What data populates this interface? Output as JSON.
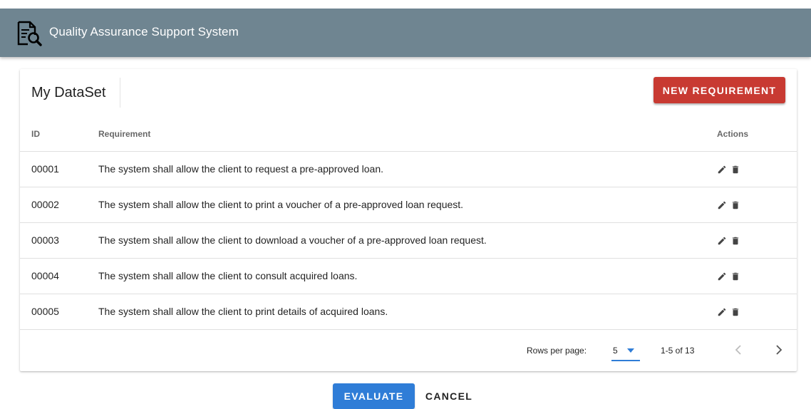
{
  "app": {
    "title": "Quality Assurance Support System",
    "header_color": "#6f8591"
  },
  "card": {
    "title": "My DataSet",
    "new_button_label": "NEW REQUIREMENT",
    "new_button_color": "#c83a32"
  },
  "table": {
    "columns": [
      "ID",
      "Requirement",
      "Actions"
    ],
    "rows": [
      {
        "id": "00001",
        "requirement": "The system shall allow the client to request a pre-approved loan."
      },
      {
        "id": "00002",
        "requirement": "The system shall allow the client to print a voucher of a pre-approved loan request."
      },
      {
        "id": "00003",
        "requirement": "The system shall allow the client to download a voucher of a pre-approved loan request."
      },
      {
        "id": "00004",
        "requirement": "The system shall allow the client to consult acquired loans."
      },
      {
        "id": "00005",
        "requirement": "The system shall allow the client to print details of acquired loans."
      }
    ],
    "row_actions": [
      "pencil-icon",
      "trash-icon"
    ]
  },
  "pagination": {
    "rows_per_page_label": "Rows per page:",
    "rows_per_page_value": "5",
    "range_text": "1-5 of 13"
  },
  "actions": {
    "evaluate_label": "EVALUATE",
    "cancel_label": "CANCEL",
    "evaluate_color": "#2f7dd7"
  },
  "icons": {
    "logo": "document-magnifier-icon",
    "prev": "chevron-left-icon",
    "next": "chevron-right-icon",
    "dropdown": "caret-down-icon"
  }
}
